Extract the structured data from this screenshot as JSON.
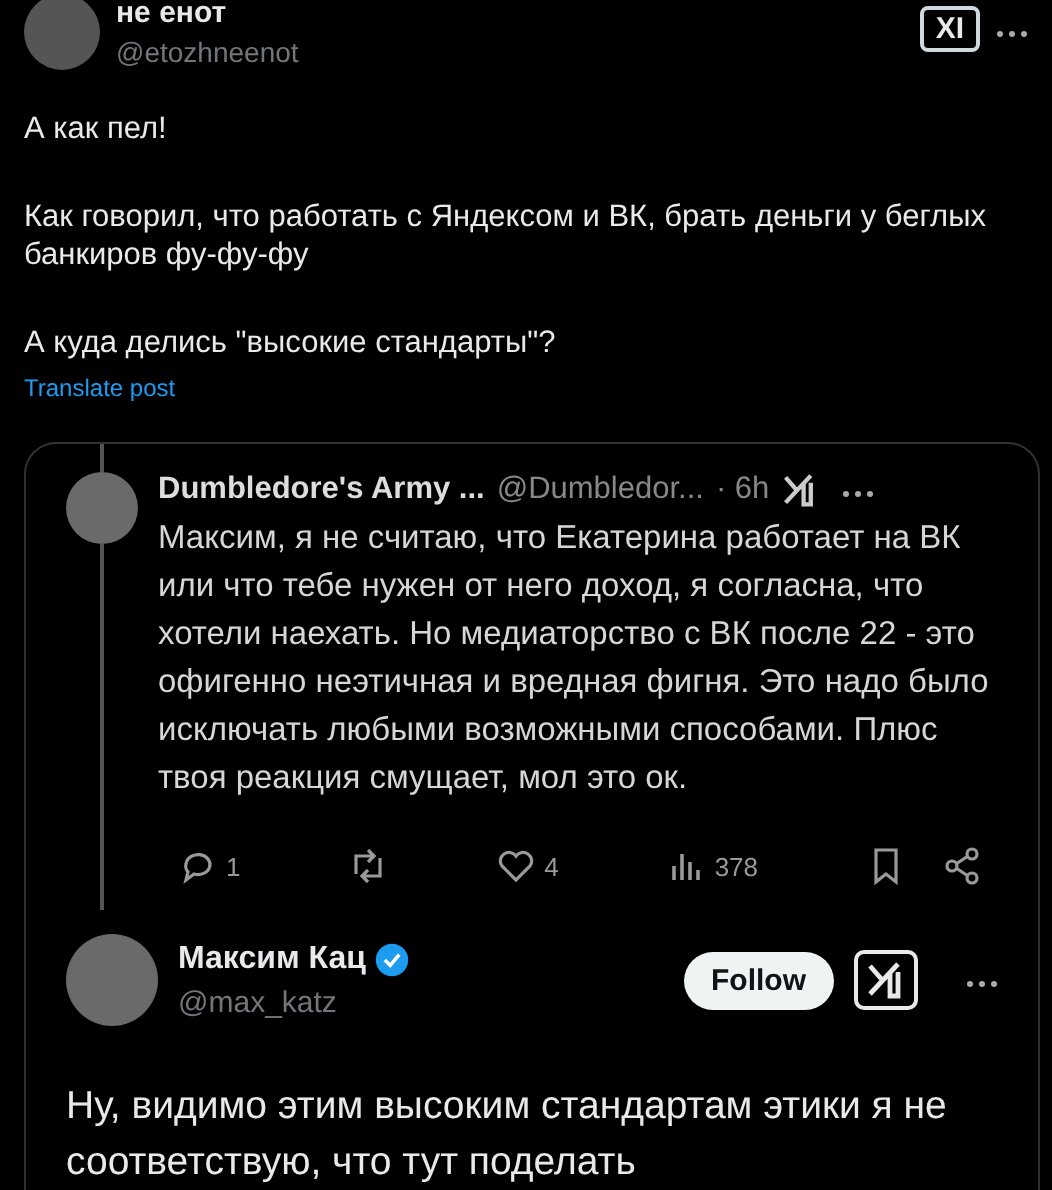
{
  "post": {
    "author_name": "не енот",
    "handle": "@etozhneenot",
    "badge": "XI",
    "paragraphs": [
      "А как пел!",
      "Как говорил, что работать с Яндексом и ВК, брать деньги у беглых банкиров фу-фу-фу",
      "А куда делись \"высокие стандарты\"?"
    ],
    "translate_link": "Translate post"
  },
  "quoted": {
    "reply": {
      "author_name": "Dumbledore's Army ...",
      "handle": "@Dumbledor...",
      "time": "· 6h",
      "text": "Максим, я не считаю, что Екатерина работает на ВК или что тебе нужен от него доход, я согласна, что хотели наехать. Но медиаторство с ВК после 22 - это офигенно неэтичная и вредная фигня. Это надо было исключать любыми возможными способами. Плюс твоя реакция смущает, мол это ок.",
      "actions": [
        {
          "kind": "reply",
          "count": "1"
        },
        {
          "kind": "repost"
        },
        {
          "kind": "like",
          "count": "4"
        },
        {
          "kind": "views",
          "count": "378"
        },
        {
          "kind": "bookmark"
        },
        {
          "kind": "share"
        }
      ]
    },
    "main": {
      "author_name": "Максим Кац",
      "verified": true,
      "handle": "@max_katz",
      "follow_button": "Follow",
      "text": "Ну, видимо этим высоким стандартам этики я не соответствую, что тут поделать"
    }
  }
}
